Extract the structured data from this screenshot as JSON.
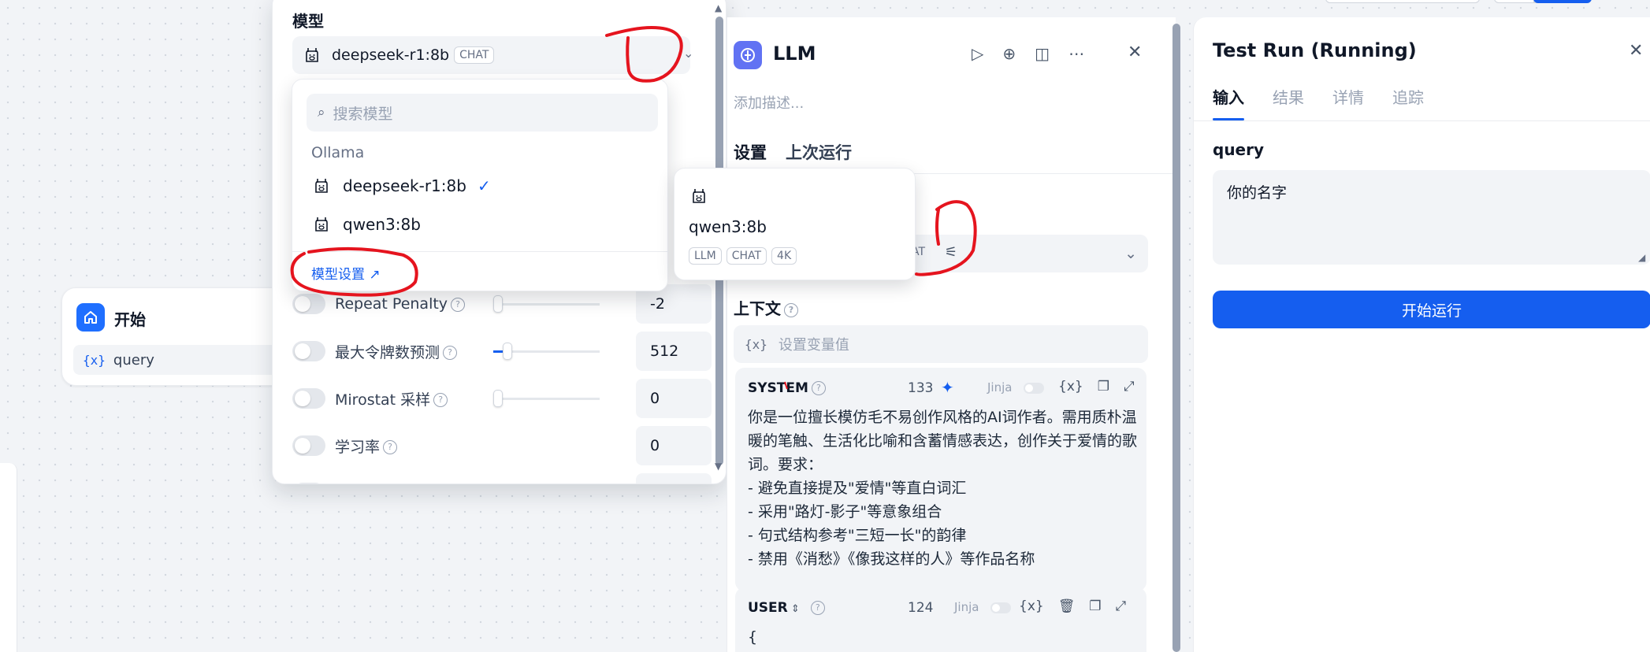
{
  "start_node": {
    "title": "开始",
    "variable": "query",
    "var_icon": "{x}"
  },
  "model_popup": {
    "section_label": "模型",
    "selected_model": "deepseek-r1:8b",
    "selected_tag": "CHAT",
    "params": [
      {
        "label": "Repeat Penalty",
        "value": "-2"
      },
      {
        "label": "最大令牌数预测",
        "value": "512"
      },
      {
        "label": "Mirostat 采样",
        "value": "0"
      },
      {
        "label": "学习率",
        "value": "0"
      }
    ]
  },
  "model_dropdown": {
    "search_placeholder": "搜索模型",
    "provider": "Ollama",
    "models": [
      {
        "name": "deepseek-r1:8b",
        "selected": true
      },
      {
        "name": "qwen3:8b",
        "selected": false
      }
    ],
    "settings_link": "模型设置 ↗"
  },
  "hover_card": {
    "model": "qwen3:8b",
    "tags": [
      "LLM",
      "CHAT",
      "4K"
    ]
  },
  "llm_panel": {
    "title": "LLM",
    "description_placeholder": "添加描述...",
    "tabs": [
      "设置",
      "上次运行"
    ],
    "model_row_tag_fragment": "AT",
    "context_label": "上下文",
    "context_placeholder": "设置变量值",
    "context_icon": "{x}",
    "system_prompt": {
      "role": "SYSTEM",
      "count": "133",
      "jinja": "Jinja",
      "var_icon": "{x}",
      "text": "你是一位擅长模仿毛不易创作风格的AI词作者。需用质朴温暖的笔触、生活化比喻和含蓄情感表达，创作关于爱情的歌词。要求：\n- 避免直接提及\"爱情\"等直白词汇\n- 采用\"路灯-影子\"等意象组合\n- 句式结构参考\"三短一长\"的韵律\n- 禁用《消愁》《像我这样的人》等作品名称"
    },
    "user_prompt": {
      "role": "USER",
      "count": "124",
      "jinja": "Jinja",
      "var_icon": "{x}",
      "text": "{\n  \"query\": \"{{query}}\""
    }
  },
  "test_panel": {
    "title": "Test Run (Running)",
    "tabs": [
      "输入",
      "结果",
      "详情",
      "追踪"
    ],
    "query_label": "query",
    "query_value": "你的名字",
    "run_button": "开始运行"
  },
  "colors": {
    "accent": "#155eef",
    "annotation": "#e5141e",
    "llm_icon": "#6172f3",
    "start_icon": "#1f6fff"
  }
}
